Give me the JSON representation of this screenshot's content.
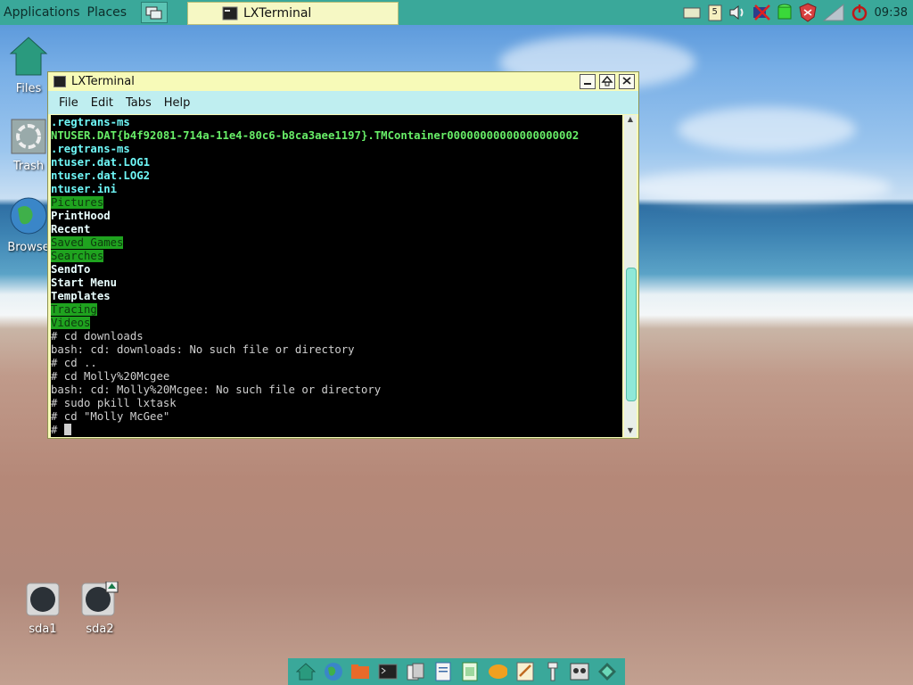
{
  "top_panel": {
    "applications_label": "Applications",
    "places_label": "Places",
    "active_task_label": "LXTerminal",
    "clock": "09:38",
    "tray_badge": "5"
  },
  "desktop": {
    "icons": [
      {
        "label": "Files"
      },
      {
        "label": "Trash"
      },
      {
        "label": "Browse"
      },
      {
        "label": "sda1"
      },
      {
        "label": "sda2"
      }
    ]
  },
  "window": {
    "title": "LXTerminal",
    "menu": [
      "File",
      "Edit",
      "Tabs",
      "Help"
    ],
    "terminal_lines": [
      {
        "text": ".regtrans-ms",
        "style": "cyan"
      },
      {
        "text": "NTUSER.DAT{b4f92081-714a-11e4-80c6-b8ca3aee1197}.TMContainer00000000000000000002",
        "style": "green"
      },
      {
        "text": ".regtrans-ms",
        "style": "cyan"
      },
      {
        "text": "ntuser.dat.LOG1",
        "style": "cyan"
      },
      {
        "text": "ntuser.dat.LOG2",
        "style": "cyan"
      },
      {
        "text": "ntuser.ini",
        "style": "cyan"
      },
      {
        "text": "Pictures",
        "style": "hl"
      },
      {
        "text": "PrintHood",
        "style": "white"
      },
      {
        "text": "Recent",
        "style": "white"
      },
      {
        "text": "Saved Games",
        "style": "hl"
      },
      {
        "text": "Searches",
        "style": "hl"
      },
      {
        "text": "SendTo",
        "style": "white"
      },
      {
        "text": "Start Menu",
        "style": "white"
      },
      {
        "text": "Templates",
        "style": "white"
      },
      {
        "text": "Tracing",
        "style": "hl"
      },
      {
        "text": "Videos",
        "style": "hl"
      },
      {
        "text": "# cd downloads",
        "style": "plain"
      },
      {
        "text": "bash: cd: downloads: No such file or directory",
        "style": "plain"
      },
      {
        "text": "# cd ..",
        "style": "plain"
      },
      {
        "text": "# cd Molly%20Mcgee",
        "style": "plain"
      },
      {
        "text": "bash: cd: Molly%20Mcgee: No such file or directory",
        "style": "plain"
      },
      {
        "text": "# sudo pkill lxtask",
        "style": "plain"
      },
      {
        "text": "# cd \"Molly McGee\"",
        "style": "plain"
      },
      {
        "text": "# ",
        "style": "prompt"
      }
    ]
  },
  "scrollbar": {
    "position_fraction": 0.84
  },
  "colors": {
    "panel": "#3aa89a",
    "window_title": "#f7fab8",
    "menubar": "#bfeef0",
    "term_bg": "#000000",
    "dir_highlight": "#1fa31f"
  }
}
